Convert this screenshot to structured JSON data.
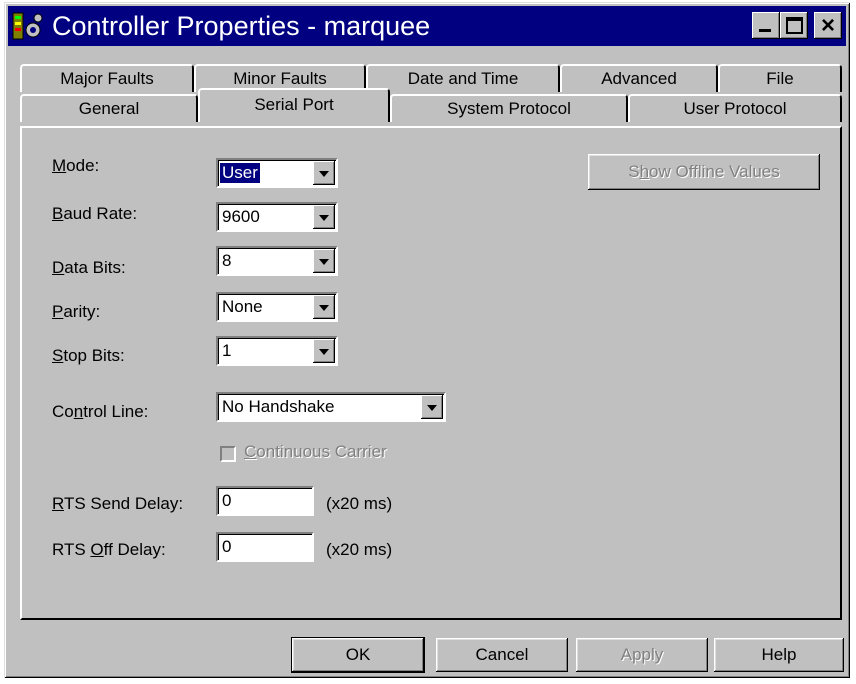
{
  "window": {
    "title": "Controller Properties - marquee",
    "close_label": "×"
  },
  "tabs_row1": [
    "Major Faults",
    "Minor Faults",
    "Date and Time",
    "Advanced",
    "File"
  ],
  "tabs_row2": [
    "General",
    "Serial Port",
    "System Protocol",
    "User Protocol"
  ],
  "active_tab": "Serial Port",
  "fields": {
    "mode": {
      "label_pre": "",
      "label_u": "M",
      "label_post": "ode:",
      "value": "User"
    },
    "baud": {
      "label_pre": "",
      "label_u": "B",
      "label_post": "aud Rate:",
      "value": "9600"
    },
    "data_bits": {
      "label_pre": "",
      "label_u": "D",
      "label_post": "ata Bits:",
      "value": "8"
    },
    "parity": {
      "label_pre": "",
      "label_u": "P",
      "label_post": "arity:",
      "value": "None"
    },
    "stop_bits": {
      "label_pre": "",
      "label_u": "S",
      "label_post": "top Bits:",
      "value": "1"
    },
    "control_line": {
      "label_pre": "Co",
      "label_u": "n",
      "label_post": "trol Line:",
      "value": "No Handshake"
    },
    "continuous_carrier": {
      "label_pre": "",
      "label_u": "C",
      "label_post": "ontinuous Carrier"
    },
    "rts_send_delay": {
      "label_pre": "",
      "label_u": "R",
      "label_post": "TS Send Delay:",
      "value": "0",
      "unit": "(x20 ms)"
    },
    "rts_off_delay": {
      "label_pre": "RTS ",
      "label_u": "O",
      "label_post": "ff Delay:",
      "value": "0",
      "unit": "(x20 ms)"
    }
  },
  "show_offline": {
    "label_pre": "S",
    "label_u": "h",
    "label_post": "ow Offline Values"
  },
  "buttons": {
    "ok": "OK",
    "cancel": "Cancel",
    "apply": "Apply",
    "help": "Help"
  }
}
